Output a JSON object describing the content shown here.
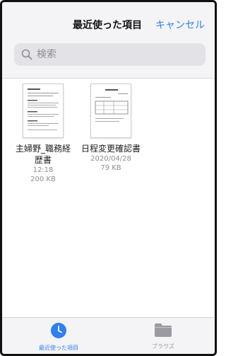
{
  "header": {
    "title": "最近使った項目",
    "cancel_label": "キャンセル"
  },
  "search": {
    "placeholder": "検索"
  },
  "files": [
    {
      "name_line1": "主婦野_職務経",
      "name_line2": "歴書",
      "time": "12:18",
      "size": "200 KB"
    },
    {
      "name_line1": "日程変更確認書",
      "name_line2": "",
      "time": "2020/04/28",
      "size": "79 KB"
    }
  ],
  "tabs": {
    "recents_label": "最近使った項目",
    "browse_label": "ブラウズ"
  },
  "colors": {
    "accent": "#2f7ff1",
    "inactive": "#9a9aa0"
  }
}
